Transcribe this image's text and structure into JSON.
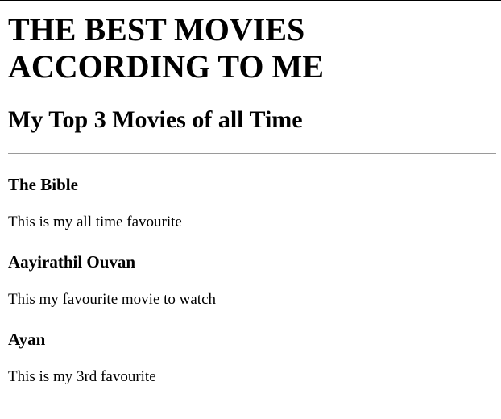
{
  "page": {
    "heading": "THE BEST MOVIES ACCORDING TO ME",
    "subheading": "My Top 3 Movies of all Time"
  },
  "movies": [
    {
      "title": "The Bible",
      "description": "This is my all time favourite"
    },
    {
      "title": "Aayirathil Ouvan",
      "description": "This my favourite movie to watch"
    },
    {
      "title": "Ayan",
      "description": "This is my 3rd favourite"
    }
  ]
}
